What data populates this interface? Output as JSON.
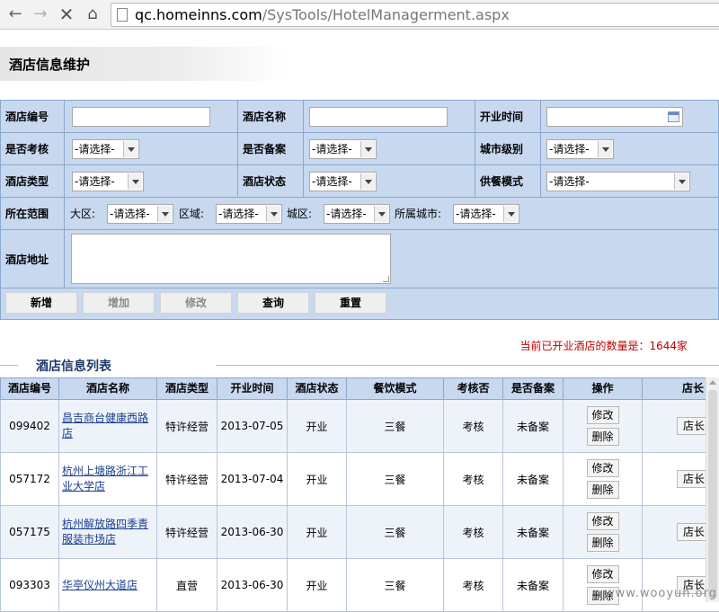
{
  "browser": {
    "url_host": "qc.homeinns.com",
    "url_path": "/SysTools/HotelManagerment.aspx",
    "back_glyph": "←",
    "forward_glyph": "→",
    "stop_glyph": "✕",
    "home_glyph": "⌂"
  },
  "page": {
    "title": "酒店信息维护"
  },
  "form": {
    "hotel_code_label": "酒店编号",
    "hotel_name_label": "酒店名称",
    "open_time_label": "开业时间",
    "is_audit_label": "是否考核",
    "is_audit_value": "-请选择-",
    "is_filed_label": "是否备案",
    "is_filed_value": "-请选择-",
    "city_level_label": "城市级别",
    "city_level_value": "-请选择-",
    "hotel_type_label": "酒店类型",
    "hotel_type_value": "-请选择-",
    "hotel_status_label": "酒店状态",
    "hotel_status_value": "-请选择-",
    "meal_mode_label": "供餐模式",
    "meal_mode_value": "-请选择-",
    "scope_label": "所在范围",
    "region_label": "大区:",
    "region_value": "-请选择-",
    "area_label": "区域:",
    "area_value": "-请选择-",
    "district_label": "城区:",
    "district_value": "-请选择-",
    "city_label": "所属城市:",
    "city_value": "-请选择-",
    "address_label": "酒店地址",
    "buttons": {
      "new": "新增",
      "add": "增加",
      "edit": "修改",
      "query": "查询",
      "reset": "重置"
    }
  },
  "summary": {
    "count_text": "当前已开业酒店的数量是：1644家"
  },
  "list": {
    "title": "酒店信息列表",
    "columns": [
      "酒店编号",
      "酒店名称",
      "酒店类型",
      "开业时间",
      "酒店状态",
      "餐饮模式",
      "考核否",
      "是否备案",
      "操作",
      "店长"
    ],
    "edit_label": "修改",
    "delete_label": "删除",
    "manager_label": "店长",
    "rows": [
      {
        "code": "099402",
        "name": "昌吉商台健康西路店",
        "type": "特许经营",
        "open_date": "2013-07-05",
        "status": "开业",
        "meal": "三餐",
        "audit": "考核",
        "filed": "未备案"
      },
      {
        "code": "057172",
        "name": "杭州上塘路浙江工业大学店",
        "type": "特许经营",
        "open_date": "2013-07-04",
        "status": "开业",
        "meal": "三餐",
        "audit": "考核",
        "filed": "未备案"
      },
      {
        "code": "057175",
        "name": "杭州解放路四季青服装市场店",
        "type": "特许经营",
        "open_date": "2013-06-30",
        "status": "开业",
        "meal": "三餐",
        "audit": "考核",
        "filed": "未备案"
      },
      {
        "code": "093303",
        "name": "华亭仪州大道店",
        "type": "直营",
        "open_date": "2013-06-30",
        "status": "开业",
        "meal": "三餐",
        "audit": "考核",
        "filed": "未备案"
      }
    ]
  },
  "watermark": "www.wooyun.org"
}
